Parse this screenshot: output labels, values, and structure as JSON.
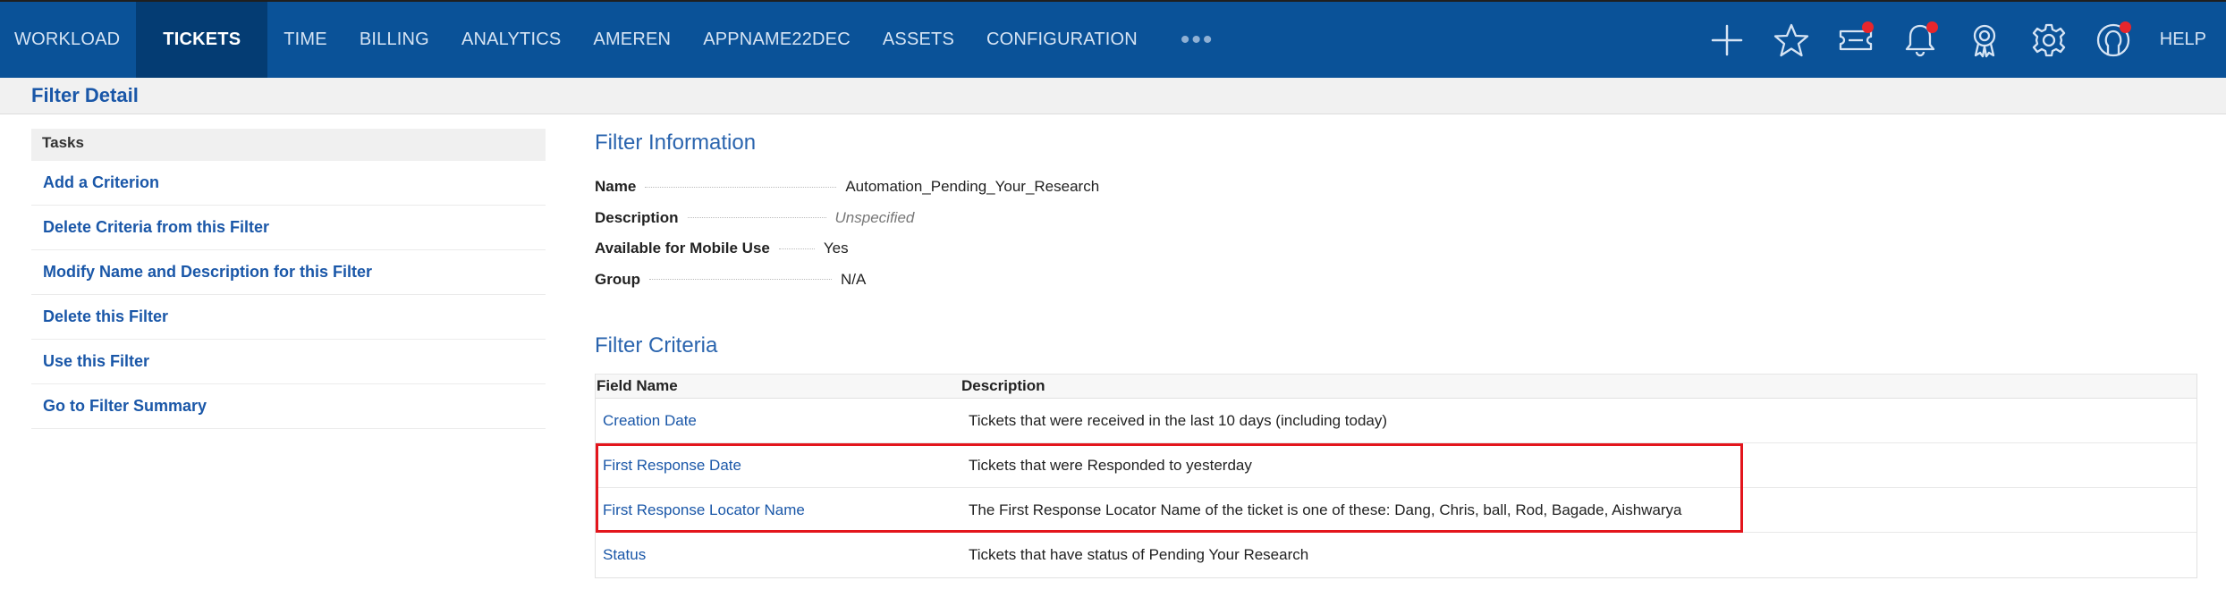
{
  "nav": {
    "items": [
      {
        "label": "WORKLOAD",
        "active": false
      },
      {
        "label": "TICKETS",
        "active": true
      },
      {
        "label": "TIME",
        "active": false
      },
      {
        "label": "BILLING",
        "active": false
      },
      {
        "label": "ANALYTICS",
        "active": false
      },
      {
        "label": "AMEREN",
        "active": false
      },
      {
        "label": "APPNAME22DEC",
        "active": false
      },
      {
        "label": "ASSETS",
        "active": false
      },
      {
        "label": "CONFIGURATION",
        "active": false
      }
    ],
    "more_label": "•••",
    "icons": [
      {
        "name": "plus-icon",
        "badge": false
      },
      {
        "name": "star-icon",
        "badge": false
      },
      {
        "name": "ticket-icon",
        "badge": true
      },
      {
        "name": "bell-icon",
        "badge": true
      },
      {
        "name": "award-icon",
        "badge": false
      },
      {
        "name": "gear-icon",
        "badge": false
      },
      {
        "name": "user-icon",
        "badge": true
      }
    ],
    "help_label": "HELP",
    "colors": {
      "bar": "#0a5298",
      "active": "#043c73",
      "badge": "#e8262c"
    }
  },
  "page": {
    "title": "Filter Detail"
  },
  "tasks": {
    "header": "Tasks",
    "items": [
      "Add a Criterion",
      "Delete Criteria from this Filter",
      "Modify Name and Description for this Filter",
      "Delete this Filter",
      "Use this Filter",
      "Go to Filter Summary"
    ]
  },
  "filter_info": {
    "title": "Filter Information",
    "rows": [
      {
        "label": "Name",
        "value": "Automation_Pending_Your_Research",
        "unspecified": false
      },
      {
        "label": "Description",
        "value": "Unspecified",
        "unspecified": true
      },
      {
        "label": "Available for Mobile Use",
        "value": "Yes",
        "unspecified": false
      },
      {
        "label": "Group",
        "value": "N/A",
        "unspecified": false
      }
    ]
  },
  "filter_criteria": {
    "title": "Filter Criteria",
    "columns": [
      "Field Name",
      "Description"
    ],
    "rows": [
      {
        "field": "Creation Date",
        "description": "Tickets that were received in the last 10 days (including today)"
      },
      {
        "field": "First Response Date",
        "description": "Tickets that were Responded to yesterday"
      },
      {
        "field": "First Response Locator Name",
        "description": "The First Response Locator Name of the ticket is one of these: Dang, Chris, ball, Rod, Bagade, Aishwarya"
      },
      {
        "field": "Status",
        "description": "Tickets that have status of Pending Your Research"
      }
    ],
    "highlight_color": "#e3151c"
  }
}
